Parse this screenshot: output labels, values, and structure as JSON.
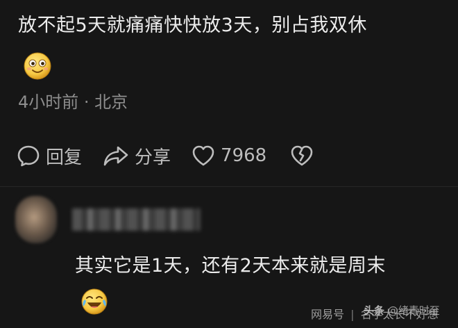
{
  "comment": {
    "text": "放不起5天就痛痛快快放3天，别占我双休",
    "emoji": "smile-emoji",
    "meta": "4小时前 · 北京"
  },
  "actions": {
    "reply_label": "回复",
    "share_label": "分享",
    "like_count": "7968"
  },
  "reply": {
    "text": "其实它是1天，还有2天本来就是周末",
    "emoji": "crying-laughing-emoji"
  },
  "watermark": {
    "source": "网易号",
    "separator": "|",
    "name": "名字太长不好想",
    "brand": "头条",
    "handle": "@绪青时至"
  },
  "colors": {
    "background": "#161616",
    "text": "#ececec",
    "meta": "#8e8e8e",
    "icon": "#bdbdbd",
    "emoji_yellow": "#f6c944"
  }
}
